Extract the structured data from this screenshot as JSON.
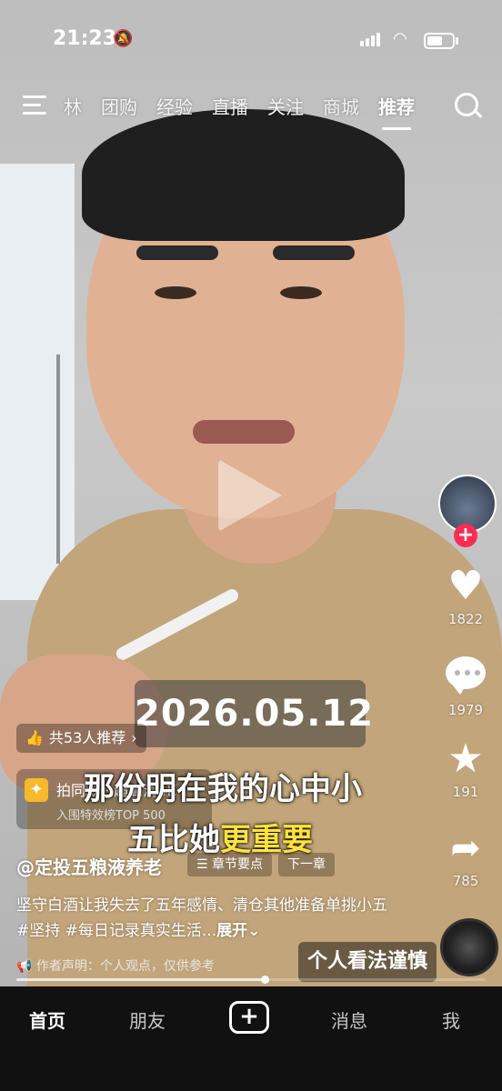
{
  "status_bar": {
    "time": "21:23",
    "battery_level": 0.6
  },
  "top_nav": {
    "tabs": [
      "林",
      "团购",
      "经验",
      "直播",
      "关注",
      "商城",
      "推荐"
    ],
    "active_tab": "推荐"
  },
  "video": {
    "date_overlay": "2026.05.12",
    "caption_line1": "那份明在我的心中小",
    "caption_line2_normal": "五比她",
    "caption_line2_highlight": "更重要",
    "opinion_overlay": "个人看法谨慎"
  },
  "recommend": {
    "label": "共53人推荐",
    "chevron": "›"
  },
  "template": {
    "label": "拍同款 · 超高清4K",
    "sublabel": "入围特效榜TOP 500"
  },
  "post": {
    "author": "@定投五粮液养老",
    "chapters_label": "☰ 章节要点",
    "next_chapter_label": "下一章",
    "description": "坚守白酒让我失去了五年感情、清仓其他准备单挑小五#坚持 #每日记录真实生活...",
    "expand_label": "展开",
    "disclaimer": "作者声明：个人观点，仅供参考",
    "progress": 0.53
  },
  "actions": {
    "likes": "1822",
    "comments": "1979",
    "favorites": "191",
    "shares": "785"
  },
  "bottom_nav": {
    "items": [
      "首页",
      "朋友",
      "消息",
      "我"
    ],
    "active": "首页"
  },
  "colors": {
    "follow_accent": "#fe2c55",
    "caption_highlight": "#ffe33b",
    "template_icon": "#f6b92b"
  }
}
